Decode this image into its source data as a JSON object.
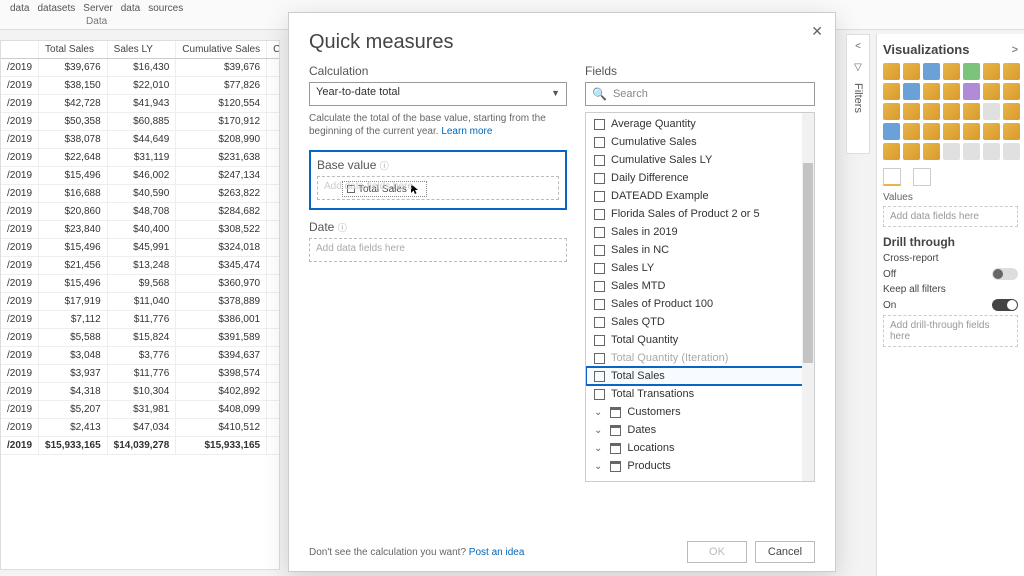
{
  "ribbon": {
    "group_data": {
      "items": [
        "data",
        "datasets",
        "Server",
        "data",
        "sources"
      ],
      "title": "Data"
    }
  },
  "table": {
    "headers": [
      "",
      "Total Sales",
      "Sales LY",
      "Cumulative Sales",
      "Cumul"
    ],
    "rows": [
      [
        "/2019",
        "$39,676",
        "$16,430",
        "$39,676",
        ""
      ],
      [
        "/2019",
        "$38,150",
        "$22,010",
        "$77,826",
        ""
      ],
      [
        "/2019",
        "$42,728",
        "$41,943",
        "$120,554",
        ""
      ],
      [
        "/2019",
        "$50,358",
        "$60,885",
        "$170,912",
        ""
      ],
      [
        "/2019",
        "$38,078",
        "$44,649",
        "$208,990",
        ""
      ],
      [
        "/2019",
        "$22,648",
        "$31,119",
        "$231,638",
        ""
      ],
      [
        "/2019",
        "$15,496",
        "$46,002",
        "$247,134",
        ""
      ],
      [
        "/2019",
        "$16,688",
        "$40,590",
        "$263,822",
        ""
      ],
      [
        "/2019",
        "$20,860",
        "$48,708",
        "$284,682",
        ""
      ],
      [
        "/2019",
        "$23,840",
        "$40,400",
        "$308,522",
        ""
      ],
      [
        "/2019",
        "$15,496",
        "$45,991",
        "$324,018",
        ""
      ],
      [
        "/2019",
        "$21,456",
        "$13,248",
        "$345,474",
        ""
      ],
      [
        "/2019",
        "$15,496",
        "$9,568",
        "$360,970",
        ""
      ],
      [
        "/2019",
        "$17,919",
        "$11,040",
        "$378,889",
        ""
      ],
      [
        "/2019",
        "$7,112",
        "$11,776",
        "$386,001",
        ""
      ],
      [
        "/2019",
        "$5,588",
        "$15,824",
        "$391,589",
        ""
      ],
      [
        "/2019",
        "$3,048",
        "$3,776",
        "$394,637",
        ""
      ],
      [
        "/2019",
        "$3,937",
        "$11,776",
        "$398,574",
        ""
      ],
      [
        "/2019",
        "$4,318",
        "$10,304",
        "$402,892",
        ""
      ],
      [
        "/2019",
        "$5,207",
        "$31,981",
        "$408,099",
        ""
      ],
      [
        "/2019",
        "$2,413",
        "$47,034",
        "$410,512",
        ""
      ]
    ],
    "total": [
      "/2019",
      "$15,933,165",
      "$14,039,278",
      "$15,933,165",
      ""
    ]
  },
  "dialog": {
    "title": "Quick measures",
    "calc_label": "Calculation",
    "calc_value": "Year-to-date total",
    "help_text": "Calculate the total of the base value, starting from the beginning of the current year. ",
    "learn_more": "Learn more",
    "base_label": "Base value",
    "base_placeholder": "Add data fields here",
    "chip_label": "Total Sales",
    "date_label": "Date",
    "date_placeholder": "Add data fields here",
    "fields_label": "Fields",
    "search_placeholder": "Search",
    "fields": [
      "Average Quantity",
      "Cumulative Sales",
      "Cumulative Sales LY",
      "Daily Difference",
      "DATEADD Example",
      "Florida Sales of Product 2 or 5",
      "Sales in 2019",
      "Sales in NC",
      "Sales LY",
      "Sales MTD",
      "Sales of Product 100",
      "Sales QTD",
      "Total Quantity",
      "Total Quantity (Iteration)",
      "Total Sales",
      "Total Transations"
    ],
    "tables": [
      "Customers",
      "Dates",
      "Locations",
      "Products"
    ],
    "highlight_field": "Total Sales",
    "footer_text": "Don't see the calculation you want? ",
    "footer_link": "Post an idea",
    "ok": "OK",
    "cancel": "Cancel"
  },
  "filters": {
    "label": "Filters"
  },
  "viz": {
    "title": "Visualizations",
    "values_label": "Values",
    "values_placeholder": "Add data fields here",
    "drill_title": "Drill through",
    "cross_report": "Cross-report",
    "off": "Off",
    "keep_filters": "Keep all filters",
    "on": "On",
    "drill_placeholder": "Add drill-through fields here"
  }
}
